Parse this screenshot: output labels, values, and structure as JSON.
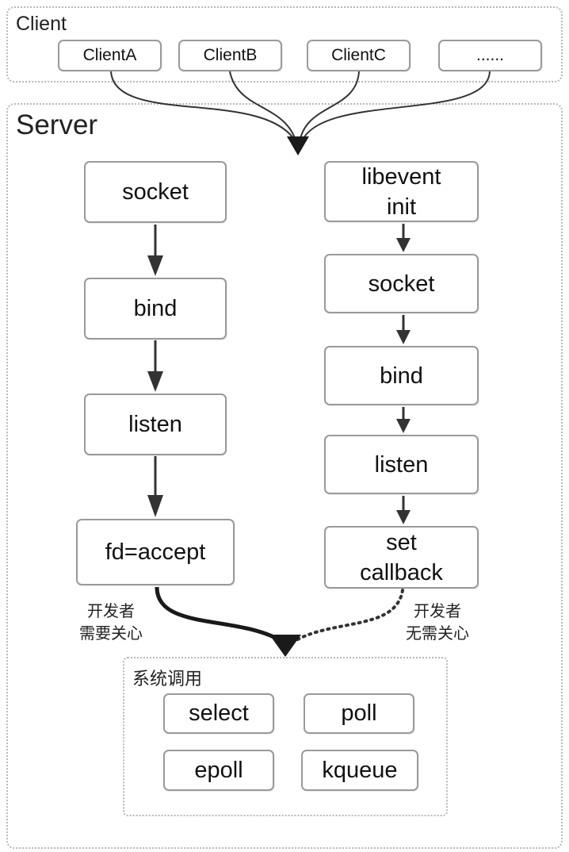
{
  "client_group": {
    "title": "Client",
    "clients": [
      "ClientA",
      "ClientB",
      "ClientC",
      "......"
    ]
  },
  "server_group": {
    "title": "Server",
    "plain_flow": [
      "socket",
      "bind",
      "listen",
      "fd=accept"
    ],
    "libevent_flow": [
      {
        "line1": "libevent",
        "line2": "init"
      },
      {
        "line1": "socket",
        "line2": ""
      },
      {
        "line1": "bind",
        "line2": ""
      },
      {
        "line1": "listen",
        "line2": ""
      },
      {
        "line1": "set",
        "line2": "callback"
      }
    ],
    "note_left": {
      "line1": "开发者",
      "line2": "需要关心"
    },
    "note_right": {
      "line1": "开发者",
      "line2": "无需关心"
    }
  },
  "syscall_group": {
    "title": "系统调用",
    "calls": [
      "select",
      "poll",
      "epoll",
      "kqueue"
    ]
  },
  "colors": {
    "arrow": "#333333",
    "box_border": "#9a9a9a",
    "group_border": "#b8b8b8"
  }
}
